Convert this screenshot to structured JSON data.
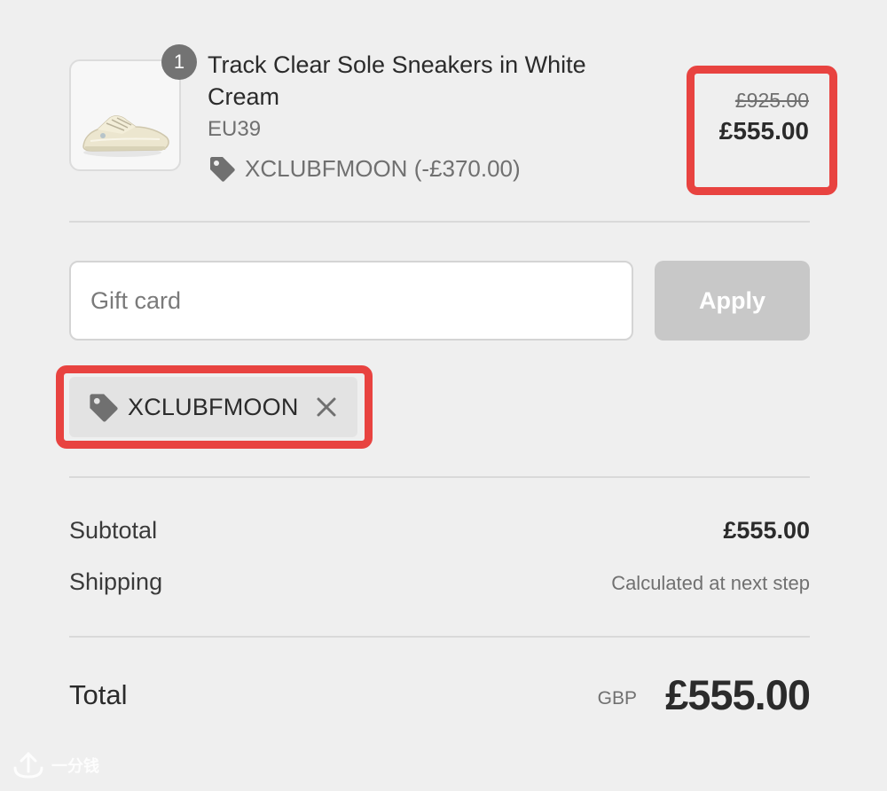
{
  "product": {
    "quantity": "1",
    "title": "Track Clear Sole Sneakers in White Cream",
    "variant": "EU39",
    "discount_code": "XCLUBFMOON",
    "discount_amount": "(-£370.00)",
    "original_price": "£925.00",
    "price": "£555.00",
    "image_icon": "sneaker-image"
  },
  "gift_card": {
    "placeholder": "Gift card",
    "value": "",
    "apply_label": "Apply"
  },
  "applied_discount": {
    "code": "XCLUBFMOON",
    "remove_icon": "close-icon"
  },
  "summary": {
    "subtotal_label": "Subtotal",
    "subtotal_value": "£555.00",
    "shipping_label": "Shipping",
    "shipping_value": "Calculated at next step",
    "total_label": "Total",
    "total_currency": "GBP",
    "total_value": "£555.00"
  },
  "watermark": {
    "text": "一分钱"
  },
  "colors": {
    "background": "#efefef",
    "highlight": "#e84340",
    "apply_disabled": "#c8c8c8",
    "chip": "#e3e3e3",
    "text_primary": "#2b2b2b",
    "text_muted": "#707070"
  }
}
